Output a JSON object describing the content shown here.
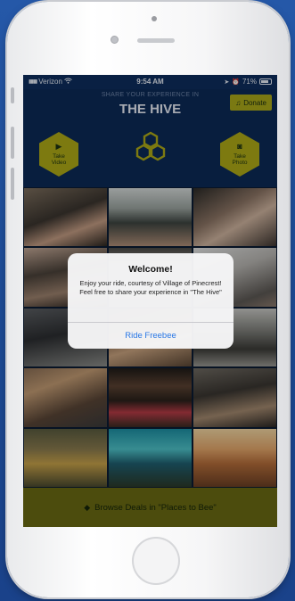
{
  "status_bar": {
    "carrier": "Verizon",
    "time": "9:54 AM",
    "battery": "71%"
  },
  "header": {
    "subtitle": "SHARE YOUR EXPERIENCE IN",
    "title": "THE HIVE",
    "donate_label": "Donate"
  },
  "actions": {
    "take_video": "Take Video",
    "take_photo": "Take Photo"
  },
  "photo_grid": {
    "count": 15
  },
  "footer": {
    "label": "Browse Deals in \"Places to Bee\""
  },
  "alert": {
    "title": "Welcome!",
    "message": "Enjoy your ride, courtesy of Village of Pinecrest! Feel free to share your experience in \"The Hive\"",
    "button_label": "Ride Freebee"
  },
  "colors": {
    "navy": "#0c2a57",
    "olive": "#aeaa17",
    "footer_olive": "#6a6a12",
    "link_blue": "#2a78e6"
  },
  "icons": [
    "wifi-icon",
    "location-icon",
    "alarm-icon",
    "battery-icon",
    "donate-icon",
    "video-camera-icon",
    "camera-icon",
    "honeycomb-logo-icon",
    "tag-icon"
  ]
}
